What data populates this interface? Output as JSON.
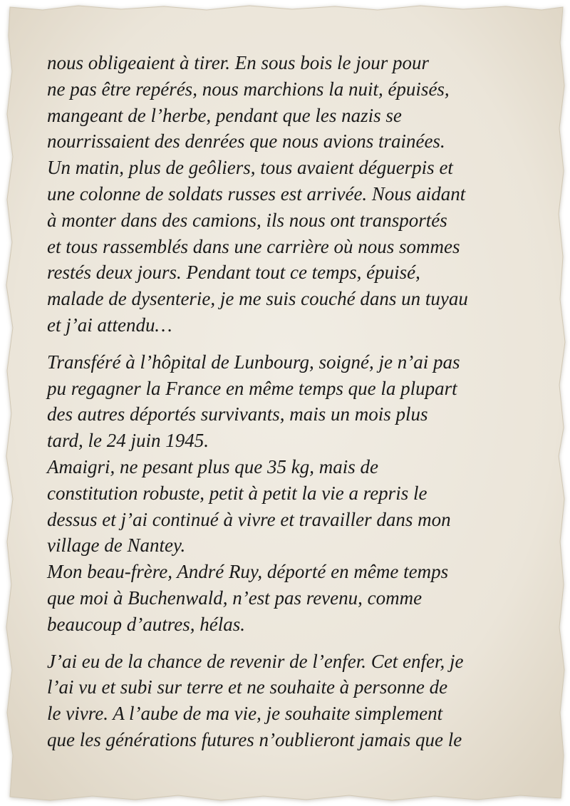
{
  "paper": {
    "fill": "#ece7dc",
    "edge": "#ddd6c8"
  },
  "paragraphs": [
    {
      "lines": [
        "nous obligeaient à tirer. En sous bois le jour pour",
        "ne pas être repérés, nous marchions la nuit, épuisés,",
        "mangeant de l’herbe, pendant que les nazis se",
        "nourrissaient des denrées que nous avions trainées.",
        "Un matin, plus de geôliers, tous avaient déguerpis et",
        "une colonne de soldats russes est arrivée. Nous aidant",
        "à monter dans des camions, ils nous ont transportés",
        "et tous rassemblés dans une carrière où nous sommes",
        "restés deux jours. Pendant tout ce temps, épuisé,",
        "malade de dysenterie, je me suis couché dans un tuyau",
        "et j’ai attendu…"
      ]
    },
    {
      "lines": [
        "Transféré à l’hôpital de Lunbourg, soigné, je n’ai pas",
        "pu regagner la France en même temps que la plupart",
        "des autres déportés survivants, mais un mois plus",
        "tard, le 24 juin 1945.",
        "Amaigri, ne pesant plus que 35 kg, mais de",
        "constitution robuste, petit à petit la vie a repris le",
        "dessus et j’ai continué à vivre et travailler dans mon",
        "village de Nantey.",
        "Mon beau-frère, André Ruy, déporté en même temps",
        "que moi à Buchenwald, n’est pas revenu, comme",
        "beaucoup d’autres, hélas."
      ]
    },
    {
      "lines": [
        "J’ai eu de la chance de revenir de l’enfer. Cet enfer, je",
        "l’ai vu et subi sur terre et ne souhaite à personne de",
        "le vivre. A l’aube de ma vie, je souhaite simplement",
        "que les générations futures n’oublieront jamais que le"
      ]
    }
  ]
}
